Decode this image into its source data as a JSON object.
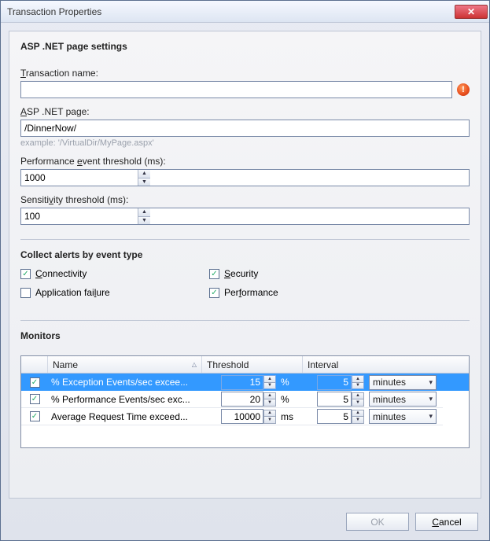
{
  "title": "Transaction Properties",
  "sections": {
    "page_settings": {
      "heading": "ASP .NET page settings",
      "transaction_name_label": "Transaction name:",
      "transaction_name_value": "",
      "asp_page_label": "ASP .NET page:",
      "asp_page_value": "/DinnerNow/",
      "asp_page_hint": "example: '/VirtualDir/MyPage.aspx'",
      "perf_threshold_label": "Performance event threshold (ms):",
      "perf_threshold_value": "1000",
      "sens_threshold_label": "Sensitivity threshold (ms):",
      "sens_threshold_value": "100"
    },
    "alerts": {
      "heading": "Collect alerts by event type",
      "connectivity": {
        "label": "Connectivity",
        "checked": true
      },
      "security": {
        "label": "Security",
        "checked": true
      },
      "app_failure": {
        "label": "Application failure",
        "checked": false
      },
      "performance": {
        "label": "Performance",
        "checked": true
      }
    },
    "monitors": {
      "heading": "Monitors",
      "columns": {
        "name": "Name",
        "threshold": "Threshold",
        "interval": "Interval"
      },
      "rows": [
        {
          "checked": true,
          "name": "% Exception Events/sec excee...",
          "threshold": "15",
          "unit": "%",
          "interval": "5",
          "interval_unit": "minutes",
          "selected": true
        },
        {
          "checked": true,
          "name": "% Performance Events/sec exc...",
          "threshold": "20",
          "unit": "%",
          "interval": "5",
          "interval_unit": "minutes",
          "selected": false
        },
        {
          "checked": true,
          "name": "Average Request Time exceed...",
          "threshold": "10000",
          "unit": "ms",
          "interval": "5",
          "interval_unit": "minutes",
          "selected": false
        }
      ]
    }
  },
  "buttons": {
    "ok": "OK",
    "cancel": "Cancel"
  }
}
